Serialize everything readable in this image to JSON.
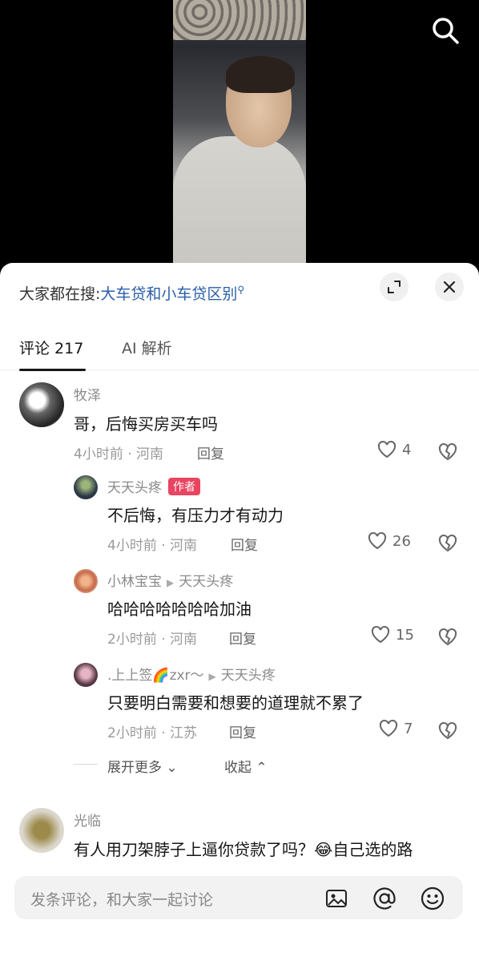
{
  "trending": {
    "prefix": "大家都在搜:",
    "query": "大车贷和小车贷区别",
    "query_icon": "search-icon"
  },
  "tabs": [
    {
      "label": "评论 217",
      "active": true
    },
    {
      "label": "AI 解析",
      "active": false
    }
  ],
  "comments": [
    {
      "name": "牧泽",
      "text": "哥，后悔买房买车吗",
      "time": "4小时前",
      "location": "河南",
      "reply_label": "回复",
      "likes": "4"
    },
    {
      "name": "天天头疼",
      "badge": "作者",
      "text": "不后悔，有压力才有动力",
      "time": "4小时前",
      "location": "河南",
      "reply_label": "回复",
      "likes": "26"
    },
    {
      "name": "小林宝宝",
      "reply_to": "天天头疼",
      "text": "哈哈哈哈哈哈哈加油",
      "time": "2小时前",
      "location": "河南",
      "reply_label": "回复",
      "likes": "15"
    },
    {
      "name": ".上上签🌈zxr～",
      "reply_to": "天天头疼",
      "text": "只要明白需要和想要的道理就不累了",
      "time": "2小时前",
      "location": "江苏",
      "reply_label": "回复",
      "likes": "7"
    },
    {
      "name": "光临",
      "text": "有人用刀架脖子上逼你贷款了吗？😂自己选的路"
    }
  ],
  "expand": {
    "more_label": "展开更多",
    "collapse_label": "收起"
  },
  "composer": {
    "placeholder": "发条评论，和大家一起讨论"
  },
  "colors": {
    "link": "#2a5fa8",
    "author_badge": "#e94560"
  }
}
